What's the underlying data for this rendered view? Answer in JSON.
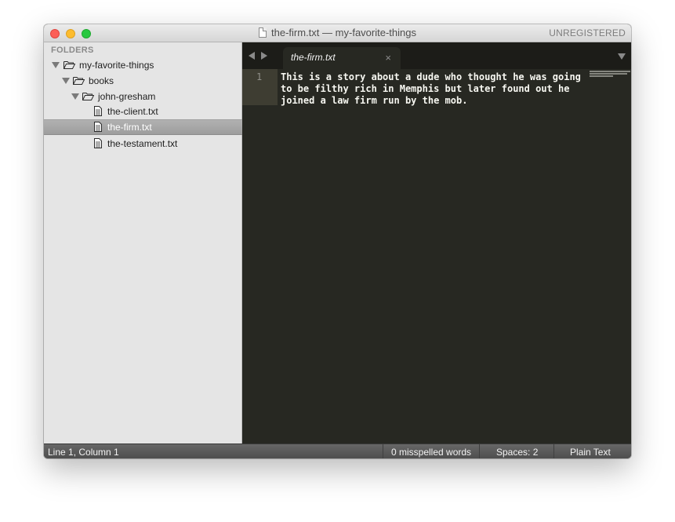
{
  "window": {
    "title_file": "the-firm.txt",
    "title_sep": "—",
    "title_project": "my-favorite-things",
    "unregistered": "UNREGISTERED"
  },
  "sidebar": {
    "header": "FOLDERS",
    "tree": [
      {
        "type": "folder",
        "label": "my-favorite-things",
        "expanded": true,
        "depth": 0
      },
      {
        "type": "folder",
        "label": "books",
        "expanded": true,
        "depth": 1
      },
      {
        "type": "folder",
        "label": "john-gresham",
        "expanded": true,
        "depth": 2
      },
      {
        "type": "file",
        "label": "the-client.txt",
        "depth": 3,
        "selected": false
      },
      {
        "type": "file",
        "label": "the-firm.txt",
        "depth": 3,
        "selected": true
      },
      {
        "type": "file",
        "label": "the-testament.txt",
        "depth": 3,
        "selected": false
      }
    ]
  },
  "tabs": [
    {
      "label": "the-firm.txt",
      "active": true,
      "close": "×"
    }
  ],
  "editor": {
    "line_numbers": [
      "1"
    ],
    "lines": [
      "This is a story about a dude who thought he was going",
      "to be filthy rich in Memphis but later found out he",
      "joined a law firm run by the mob."
    ]
  },
  "statusbar": {
    "position": "Line 1, Column 1",
    "spelling": "0 misspelled words",
    "indentation": "Spaces: 2",
    "syntax": "Plain Text"
  },
  "colors": {
    "editor_bg": "#272822",
    "editor_text": "#f8f8f2",
    "sidebar_bg": "#e5e5e5",
    "selection": "#a5a5a5"
  },
  "icons": {
    "close": "close-button",
    "minimize": "minimize-button",
    "maximize": "zoom-button",
    "folder": "folder-open-icon",
    "file": "text-file-icon"
  }
}
